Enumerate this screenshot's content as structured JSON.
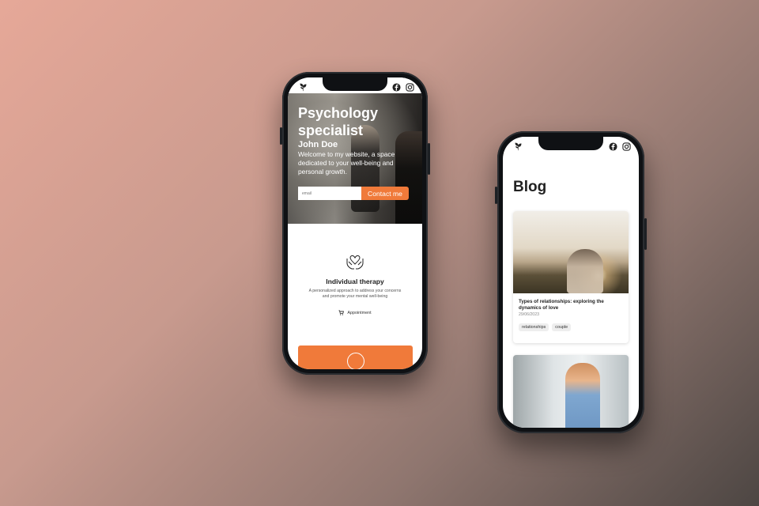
{
  "colors": {
    "accent": "#f07a3a",
    "background_start": "#e6a898",
    "background_end": "#4d4643"
  },
  "phone1": {
    "statusbar": {
      "logo_icon": "leaf-icon",
      "icons": [
        "facebook-icon",
        "instagram-icon"
      ]
    },
    "hero": {
      "title": "Psychology specialist",
      "name": "John Doe",
      "description": "Welcome to my website, a space dedicated to your well-being and personal growth.",
      "email_placeholder": "email",
      "contact_button": "Contact me"
    },
    "service": {
      "icon": "heart-hands-icon",
      "title": "Individual therapy",
      "description": "A personalized approach to address your concerns and promote your mental well-being",
      "appointment_icon": "cart-icon",
      "appointment_label": "Appointment"
    },
    "next_card_icon": "head-brain-icon"
  },
  "phone2": {
    "statusbar": {
      "logo_icon": "leaf-icon",
      "icons": [
        "facebook-icon",
        "instagram-icon"
      ]
    },
    "page_title": "Blog",
    "posts": [
      {
        "title": "Types of relationships: exploring the dynamics of love",
        "date": "29/06/2023",
        "tags": [
          "relationships",
          "couple"
        ]
      }
    ]
  }
}
